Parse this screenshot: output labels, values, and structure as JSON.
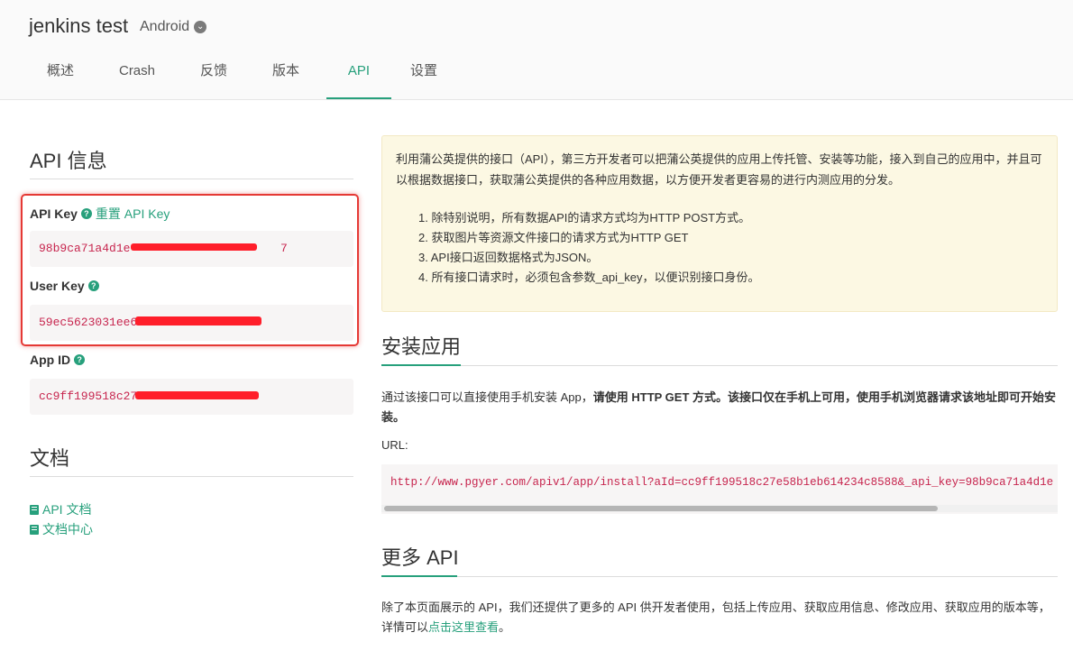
{
  "app": {
    "name": "jenkins test",
    "platform": "Android"
  },
  "tabs": [
    {
      "label": "概述"
    },
    {
      "label": "Crash"
    },
    {
      "label": "反馈"
    },
    {
      "label": "版本"
    },
    {
      "label": "API"
    },
    {
      "label": "设置"
    }
  ],
  "api_info": {
    "title": "API 信息",
    "api_key_label": "API Key",
    "reset_link": "重置 API Key",
    "api_key_value": "98b9ca71a4d1e",
    "api_key_tail": "7",
    "user_key_label": "User Key",
    "user_key_value": "59ec5623031ee6",
    "user_key_tail": "",
    "app_id_label": "App ID",
    "app_id_value": "cc9ff199518c27e",
    "app_id_tail": ""
  },
  "docs": {
    "title": "文档",
    "links": [
      {
        "label": "API 文档"
      },
      {
        "label": "文档中心"
      }
    ]
  },
  "notice": {
    "intro": "利用蒲公英提供的接口（API），第三方开发者可以把蒲公英提供的应用上传托管、安装等功能，接入到自己的应用中，并且可以根据数据接口，获取蒲公英提供的各种应用数据，以方便开发者更容易的进行内测应用的分发。",
    "items": [
      "1. 除特别说明，所有数据API的请求方式均为HTTP POST方式。",
      "2. 获取图片等资源文件接口的请求方式为HTTP GET",
      "3. API接口返回数据格式为JSON。",
      "4. 所有接口请求时，必须包含参数_api_key，以便识别接口身份。"
    ]
  },
  "install": {
    "title": "安装应用",
    "desc_normal": "通过该接口可以直接使用手机安装 App，",
    "desc_bold": "请使用 HTTP GET 方式。该接口仅在手机上可用，使用手机浏览器请求该地址即可开始安装。",
    "url_label": "URL:",
    "url": "http://www.pgyer.com/apiv1/app/install?aId=cc9ff199518c27e58b1eb614234c8588&_api_key=98b9ca71a4d1e"
  },
  "more_api": {
    "title": "更多 API",
    "desc": "除了本页面展示的 API，我们还提供了更多的 API 供开发者使用，包括上传应用、获取应用信息、修改应用、获取应用的版本等，详情可以",
    "link": "点击这里查看",
    "suffix": "。"
  },
  "colors": {
    "accent": "#27a07c",
    "code": "#c7254e",
    "notice_bg": "#fcf8e3",
    "redaction": "#ff1e2a"
  }
}
